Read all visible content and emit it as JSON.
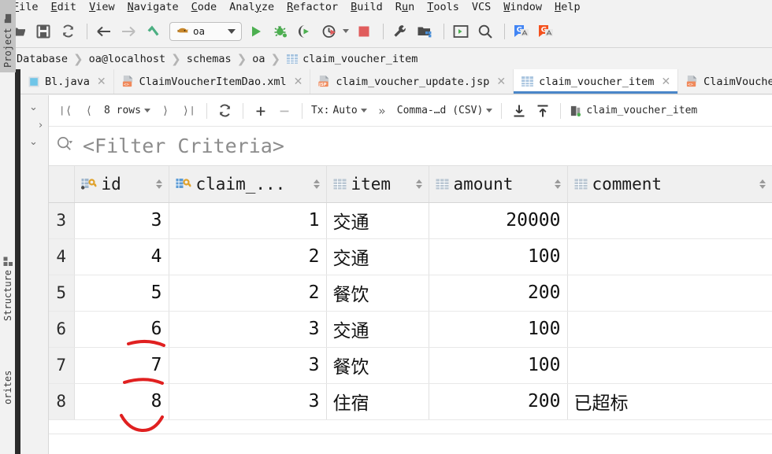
{
  "window": {
    "title": "claim_voucher_item"
  },
  "menubar": {
    "items": [
      {
        "pre": "",
        "mn": "F",
        "post": "ile"
      },
      {
        "pre": "",
        "mn": "E",
        "post": "dit"
      },
      {
        "pre": "",
        "mn": "V",
        "post": "iew"
      },
      {
        "pre": "",
        "mn": "N",
        "post": "avigate"
      },
      {
        "pre": "",
        "mn": "C",
        "post": "ode"
      },
      {
        "pre": "Anal",
        "mn": "y",
        "post": "ze"
      },
      {
        "pre": "",
        "mn": "R",
        "post": "efactor"
      },
      {
        "pre": "",
        "mn": "B",
        "post": "uild"
      },
      {
        "pre": "R",
        "mn": "u",
        "post": "n"
      },
      {
        "pre": "",
        "mn": "T",
        "post": "ools"
      },
      {
        "pre": "VCS",
        "mn": "",
        "post": ""
      },
      {
        "pre": "",
        "mn": "W",
        "post": "indow"
      },
      {
        "pre": "",
        "mn": "H",
        "post": "elp"
      }
    ]
  },
  "toolbar": {
    "open_label": "open-project",
    "save_label": "save-all",
    "sync_label": "synchronize",
    "back_label": "navigate-back",
    "forward_label": "navigate-forward",
    "update_label": "update-project",
    "run_config": "oa",
    "run_label": "Run",
    "debug_label": "Debug",
    "coverage_label": "Run with Coverage",
    "profile_label": "Profile",
    "stop_label": "Stop",
    "settings_label": "Settings",
    "structure_label": "Project Structure",
    "terminal_label": "Terminal",
    "search_label": "Search Everywhere",
    "translate_blue_label": "Translate",
    "translate_red_label": "Translate Reverse"
  },
  "breadcrumb": {
    "items": [
      "Database",
      "oa@localhost",
      "schemas",
      "oa",
      "claim_voucher_item"
    ],
    "separator": "❯"
  },
  "left_strip": {
    "project": "Project",
    "structure": "Structure",
    "favorites": "orites"
  },
  "editor_tabs": [
    {
      "label": "Bl.java",
      "icon": "java-file-icon",
      "active": false,
      "closable": true
    },
    {
      "label": "ClaimVoucherItemDao.xml",
      "icon": "xml-file-icon",
      "active": false,
      "closable": true
    },
    {
      "label": "claim_voucher_update.jsp",
      "icon": "jsp-file-icon",
      "active": false,
      "closable": true
    },
    {
      "label": "claim_voucher_item",
      "icon": "table-icon",
      "active": true,
      "closable": true
    },
    {
      "label": "ClaimVoucherDa",
      "icon": "xml-file-icon",
      "active": false,
      "closable": false
    }
  ],
  "grid_toolbar": {
    "first_page": "❘⟨",
    "prev_page": "⟨",
    "rows_label": "8 rows",
    "next_page": "⟩",
    "last_page": "⟩❘",
    "reload_label": "reload-data",
    "add_row": "+",
    "delete_row": "−",
    "tx_label": "Tx:",
    "tx_value": "Auto",
    "expand_label": "»",
    "format_value": "Comma-…d (CSV)",
    "download_label": "dump-data",
    "upload_label": "import-data",
    "console_label": "claim_voucher_item"
  },
  "filter": {
    "placeholder": "<Filter Criteria>",
    "icon": "filter-search-icon"
  },
  "table": {
    "columns": [
      {
        "key": "rownum",
        "label": "",
        "icon": "",
        "sortable": false
      },
      {
        "key": "id",
        "label": "id",
        "icon": "primary-key-icon",
        "sortable": true
      },
      {
        "key": "claim",
        "label": "claim_...",
        "icon": "foreign-key-icon",
        "sortable": true
      },
      {
        "key": "item",
        "label": "item",
        "icon": "column-icon",
        "sortable": true
      },
      {
        "key": "amount",
        "label": "amount",
        "icon": "column-icon",
        "sortable": true
      },
      {
        "key": "comment",
        "label": "comment",
        "icon": "column-icon",
        "sortable": true
      }
    ],
    "rows": [
      {
        "rownum": "3",
        "id": "3",
        "claim": "1",
        "item": "交通",
        "amount": "20000",
        "comment": ""
      },
      {
        "rownum": "4",
        "id": "4",
        "claim": "2",
        "item": "交通",
        "amount": "100",
        "comment": ""
      },
      {
        "rownum": "5",
        "id": "5",
        "claim": "2",
        "item": "餐饮",
        "amount": "200",
        "comment": ""
      },
      {
        "rownum": "6",
        "id": "6",
        "claim": "3",
        "item": "交通",
        "amount": "100",
        "comment": ""
      },
      {
        "rownum": "7",
        "id": "7",
        "claim": "3",
        "item": "餐饮",
        "amount": "100",
        "comment": ""
      },
      {
        "rownum": "8",
        "id": "8",
        "claim": "3",
        "item": "住宿",
        "amount": "200",
        "comment": "已超标"
      }
    ]
  },
  "annotations": {
    "color": "#e02020",
    "marks": [
      "underline-under-id-6",
      "underline-under-id-7",
      "curve-under-id-8"
    ]
  },
  "colors": {
    "accent": "#4a86c8",
    "run_green": "#4caf50",
    "stop_red": "#e05c5c",
    "header_bg": "#f0f0f0",
    "chrome_bg": "#f2f2f2"
  }
}
